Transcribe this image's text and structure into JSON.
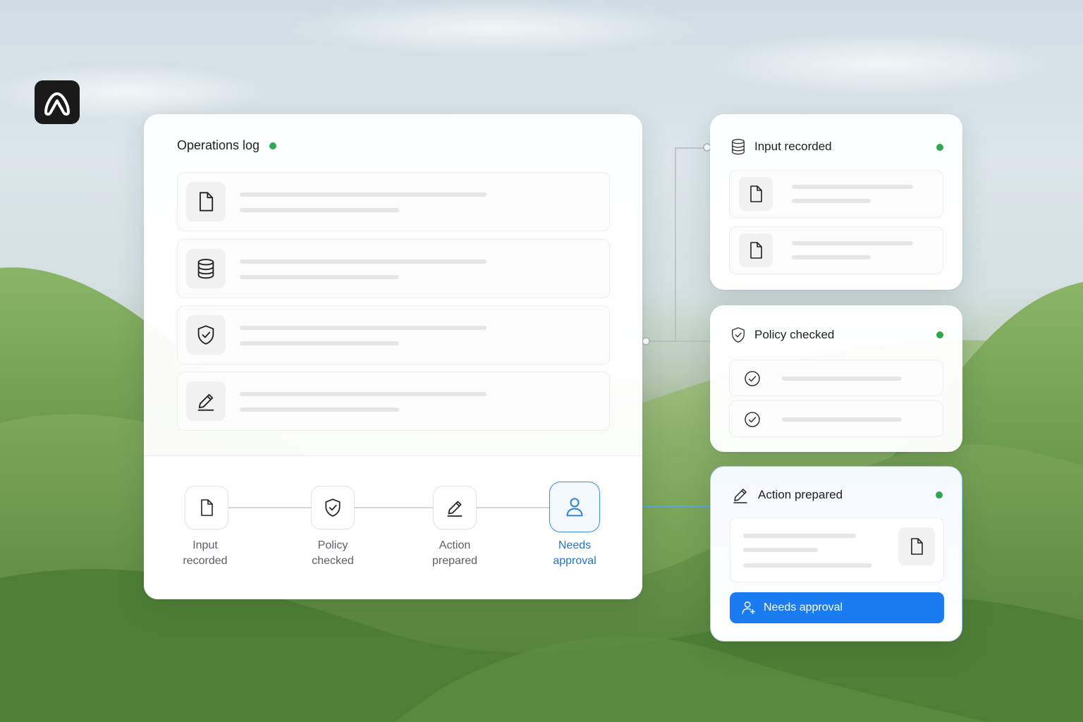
{
  "app": {
    "logo_icon": "wave-logo-icon"
  },
  "log": {
    "title": "Operations log",
    "status_color": "#2fa84f",
    "rows": [
      {
        "icon": "document-icon"
      },
      {
        "icon": "database-icon"
      },
      {
        "icon": "shield-check-icon"
      },
      {
        "icon": "pencil-icon"
      }
    ]
  },
  "steps": [
    {
      "label": "Input\nrecorded",
      "icon": "document-icon"
    },
    {
      "label": "Policy\nchecked",
      "icon": "shield-check-icon"
    },
    {
      "label": "Action\nprepared",
      "icon": "pencil-icon"
    },
    {
      "label": "Needs\napproval",
      "icon": "user-icon",
      "active": true
    }
  ],
  "panels": {
    "input": {
      "title": "Input recorded",
      "icon": "database-icon"
    },
    "policy": {
      "title": "Policy checked",
      "icon": "shield-check-icon"
    },
    "action": {
      "title": "Action prepared",
      "icon": "pencil-icon",
      "button_label": "Needs approval"
    }
  },
  "colors": {
    "accent": "#1a7cf0",
    "active_step": "#1f73d3",
    "status": "#2fa84f"
  }
}
